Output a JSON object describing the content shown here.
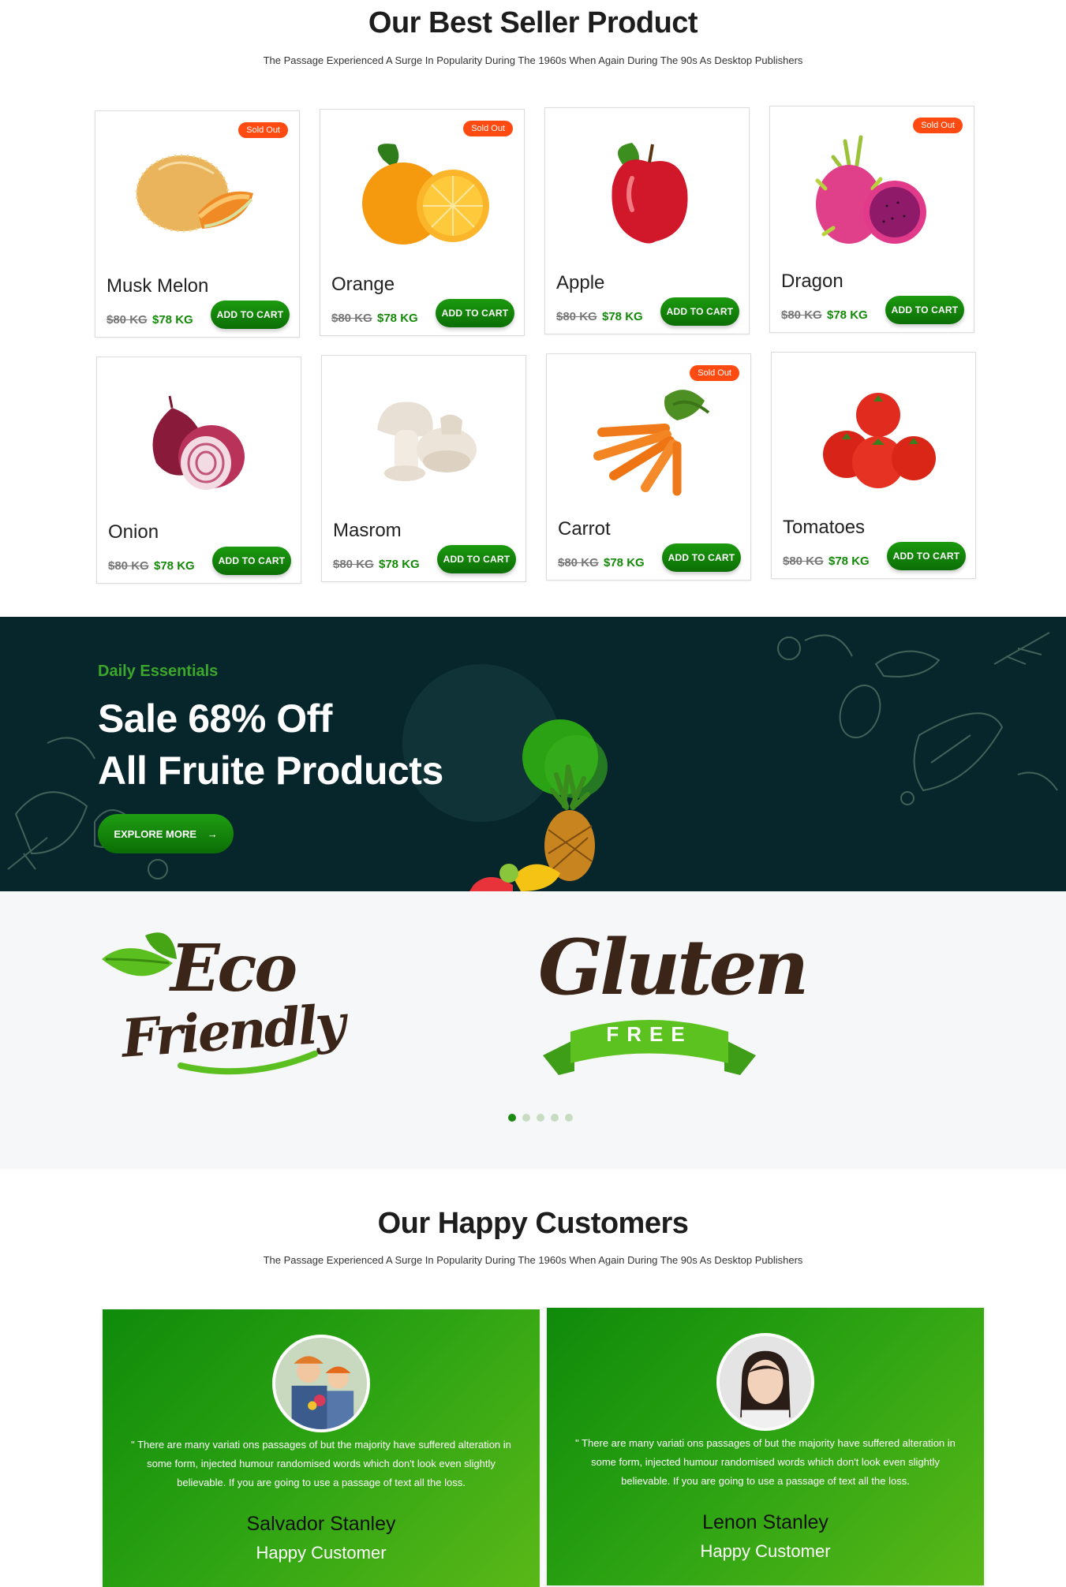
{
  "best_sellers": {
    "title": "Our Best Seller Product",
    "subtitle": "The Passage Experienced A Surge In Popularity During The 1960s When Again During The 90s As Desktop Publishers",
    "products": [
      {
        "name": "Musk Melon",
        "old_price": "$80 KG",
        "new_price": "$78 KG",
        "badge": "Sold Out",
        "cta": "ADD TO CART",
        "icon": "melon-icon"
      },
      {
        "name": "Orange",
        "old_price": "$80 KG",
        "new_price": "$78 KG",
        "badge": "Sold Out",
        "cta": "ADD TO CART",
        "icon": "orange-icon"
      },
      {
        "name": "Apple",
        "old_price": "$80 KG",
        "new_price": "$78 KG",
        "badge": "",
        "cta": "ADD TO CART",
        "icon": "apple-icon"
      },
      {
        "name": "Dragon",
        "old_price": "$80 KG",
        "new_price": "$78 KG",
        "badge": "Sold Out",
        "cta": "ADD TO CART",
        "icon": "dragon-fruit-icon"
      },
      {
        "name": "Onion",
        "old_price": "$80 KG",
        "new_price": "$78 KG",
        "badge": "",
        "cta": "ADD TO CART",
        "icon": "onion-icon"
      },
      {
        "name": "Masrom",
        "old_price": "$80 KG",
        "new_price": "$78 KG",
        "badge": "",
        "cta": "ADD TO CART",
        "icon": "mushroom-icon"
      },
      {
        "name": "Carrot",
        "old_price": "$80 KG",
        "new_price": "$78 KG",
        "badge": "Sold Out",
        "cta": "ADD TO CART",
        "icon": "carrot-icon"
      },
      {
        "name": "Tomatoes",
        "old_price": "$80 KG",
        "new_price": "$78 KG",
        "badge": "",
        "cta": "ADD TO CART",
        "icon": "tomato-icon"
      }
    ]
  },
  "promo": {
    "eyebrow": "Daily Essentials",
    "headline_line1": "Sale 68% Off",
    "headline_line2": "All Fruite Products",
    "cta": "EXPLORE MORE",
    "cta_arrow": "→"
  },
  "partners": {
    "logo1_word1": "Eco",
    "logo1_word2": "Friendly",
    "logo2_word1": "Gluten",
    "logo2_word2": "FREE",
    "active_slide": 1,
    "slide_count": 5
  },
  "testimonials": {
    "title": "Our Happy Customers",
    "subtitle": "The Passage Experienced A Surge In Popularity During The 1960s When Again During The 90s As Desktop Publishers",
    "items": [
      {
        "quote": "\" There are many variati ons passages of but the majority have suffered alteration in some form, injected humour randomised words which don't look even slightly believable. If you are going to use a passage of text all the loss.",
        "name": "Salvador Stanley",
        "role": "Happy Customer"
      },
      {
        "quote": "\" There are many variati ons passages of but the majority have suffered alteration in some form, injected humour randomised words which don't look even slightly believable. If you are going to use a passage of text all the loss.",
        "name": "Lenon Stanley",
        "role": "Happy Customer"
      }
    ]
  },
  "colors": {
    "brand_green": "#138a07",
    "sold_out_orange": "#ff4a11",
    "promo_bg": "#06262b"
  }
}
